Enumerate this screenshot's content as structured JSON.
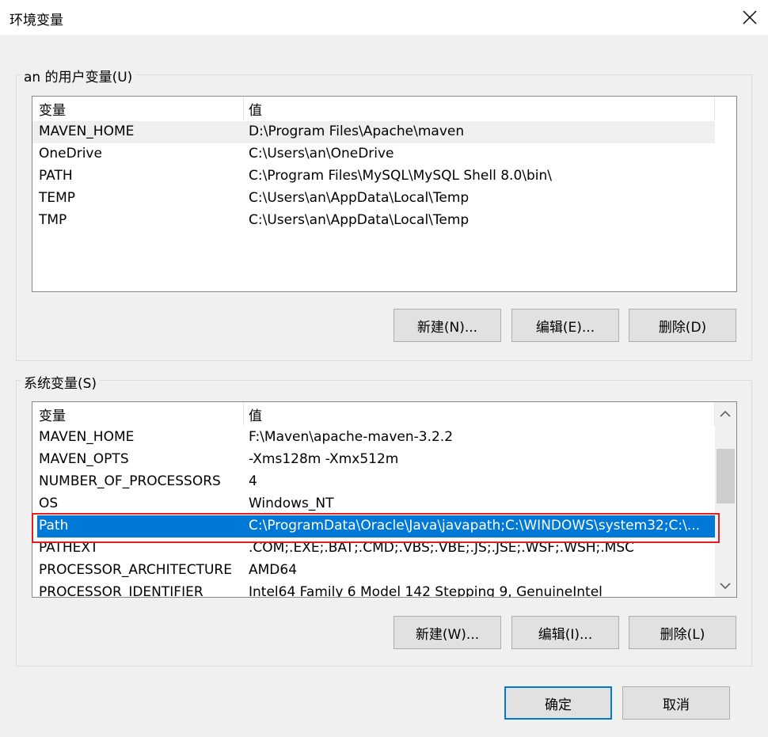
{
  "window": {
    "title": "环境变量"
  },
  "user_section": {
    "title": "an 的用户变量(U)",
    "columns": [
      "变量",
      "值"
    ],
    "rows": [
      {
        "name": "MAVEN_HOME",
        "value": "D:\\Program Files\\Apache\\maven"
      },
      {
        "name": "OneDrive",
        "value": "C:\\Users\\an\\OneDrive"
      },
      {
        "name": "PATH",
        "value": "C:\\Program Files\\MySQL\\MySQL Shell 8.0\\bin\\"
      },
      {
        "name": "TEMP",
        "value": "C:\\Users\\an\\AppData\\Local\\Temp"
      },
      {
        "name": "TMP",
        "value": "C:\\Users\\an\\AppData\\Local\\Temp"
      }
    ],
    "buttons": {
      "new": "新建(N)...",
      "edit": "编辑(E)...",
      "delete": "删除(D)"
    }
  },
  "system_section": {
    "title": "系统变量(S)",
    "columns": [
      "变量",
      "值"
    ],
    "rows": [
      {
        "name": "MAVEN_HOME",
        "value": "F:\\Maven\\apache-maven-3.2.2"
      },
      {
        "name": "MAVEN_OPTS",
        "value": "-Xms128m  -Xmx512m"
      },
      {
        "name": "NUMBER_OF_PROCESSORS",
        "value": "4"
      },
      {
        "name": "OS",
        "value": "Windows_NT"
      },
      {
        "name": "Path",
        "value": "C:\\ProgramData\\Oracle\\Java\\javapath;C:\\WINDOWS\\system32;C:\\..."
      },
      {
        "name": "PATHEXT",
        "value": ".COM;.EXE;.BAT;.CMD;.VBS;.VBE;.JS;.JSE;.WSF;.WSH;.MSC"
      },
      {
        "name": "PROCESSOR_ARCHITECTURE",
        "value": "AMD64"
      },
      {
        "name": "PROCESSOR_IDENTIFIER",
        "value": "Intel64 Family 6 Model 142 Stepping 9, GenuineIntel"
      }
    ],
    "selected_row": "Path",
    "buttons": {
      "new": "新建(W)...",
      "edit": "编辑(I)...",
      "delete": "删除(L)"
    }
  },
  "footer": {
    "ok": "确定",
    "cancel": "取消"
  },
  "colors": {
    "selection": "#0078d7",
    "highlight_box": "#e02020"
  },
  "icons": {
    "close": "close-icon",
    "scroll_up": "chevron-up-icon",
    "scroll_down": "chevron-down-icon"
  }
}
